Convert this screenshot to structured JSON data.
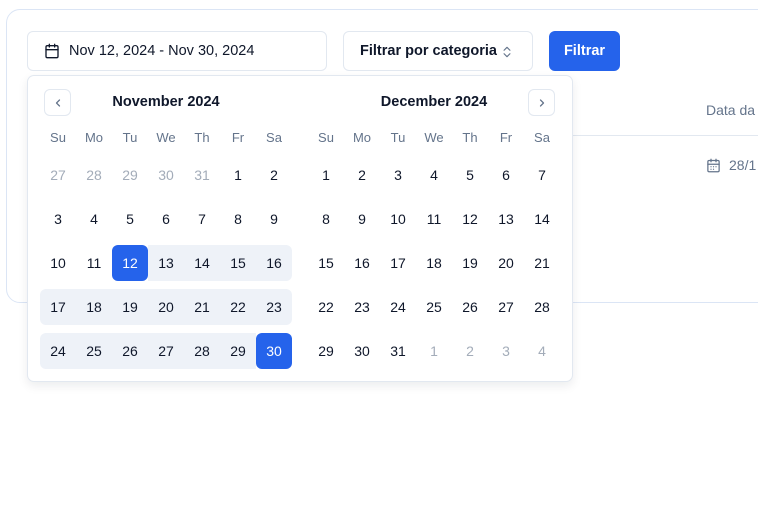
{
  "toolbar": {
    "date_range": "Nov 12, 2024 - Nov 30, 2024",
    "category_placeholder": "Filtrar por categoria",
    "filter_label": "Filtrar"
  },
  "table": {
    "partial_header": "Data da",
    "partial_cell": "28/1"
  },
  "calendar": {
    "weekdays": [
      "Su",
      "Mo",
      "Tu",
      "We",
      "Th",
      "Fr",
      "Sa"
    ],
    "months": [
      {
        "title": "November 2024",
        "weeks": [
          [
            {
              "d": "27",
              "out": true
            },
            {
              "d": "28",
              "out": true
            },
            {
              "d": "29",
              "out": true
            },
            {
              "d": "30",
              "out": true
            },
            {
              "d": "31",
              "out": true
            },
            {
              "d": "1"
            },
            {
              "d": "2"
            }
          ],
          [
            {
              "d": "3"
            },
            {
              "d": "4"
            },
            {
              "d": "5"
            },
            {
              "d": "6"
            },
            {
              "d": "7"
            },
            {
              "d": "8"
            },
            {
              "d": "9"
            }
          ],
          [
            {
              "d": "10"
            },
            {
              "d": "11"
            },
            {
              "d": "12",
              "state": "start"
            },
            {
              "d": "13",
              "state": "range"
            },
            {
              "d": "14",
              "state": "range"
            },
            {
              "d": "15",
              "state": "range"
            },
            {
              "d": "16",
              "state": "range"
            }
          ],
          [
            {
              "d": "17",
              "state": "range"
            },
            {
              "d": "18",
              "state": "range"
            },
            {
              "d": "19",
              "state": "range"
            },
            {
              "d": "20",
              "state": "range"
            },
            {
              "d": "21",
              "state": "range"
            },
            {
              "d": "22",
              "state": "range"
            },
            {
              "d": "23",
              "state": "range"
            }
          ],
          [
            {
              "d": "24",
              "state": "range"
            },
            {
              "d": "25",
              "state": "range"
            },
            {
              "d": "26",
              "state": "range"
            },
            {
              "d": "27",
              "state": "range"
            },
            {
              "d": "28",
              "state": "range"
            },
            {
              "d": "29",
              "state": "range"
            },
            {
              "d": "30",
              "state": "end"
            }
          ]
        ]
      },
      {
        "title": "December 2024",
        "weeks": [
          [
            {
              "d": "1"
            },
            {
              "d": "2"
            },
            {
              "d": "3"
            },
            {
              "d": "4"
            },
            {
              "d": "5"
            },
            {
              "d": "6"
            },
            {
              "d": "7"
            }
          ],
          [
            {
              "d": "8"
            },
            {
              "d": "9"
            },
            {
              "d": "10"
            },
            {
              "d": "11"
            },
            {
              "d": "12"
            },
            {
              "d": "13"
            },
            {
              "d": "14"
            }
          ],
          [
            {
              "d": "15"
            },
            {
              "d": "16"
            },
            {
              "d": "17"
            },
            {
              "d": "18"
            },
            {
              "d": "19"
            },
            {
              "d": "20"
            },
            {
              "d": "21"
            }
          ],
          [
            {
              "d": "22"
            },
            {
              "d": "23"
            },
            {
              "d": "24"
            },
            {
              "d": "25"
            },
            {
              "d": "26"
            },
            {
              "d": "27"
            },
            {
              "d": "28"
            }
          ],
          [
            {
              "d": "29"
            },
            {
              "d": "30"
            },
            {
              "d": "31"
            },
            {
              "d": "1",
              "out": true
            },
            {
              "d": "2",
              "out": true
            },
            {
              "d": "3",
              "out": true
            },
            {
              "d": "4",
              "out": true
            }
          ]
        ]
      }
    ]
  }
}
